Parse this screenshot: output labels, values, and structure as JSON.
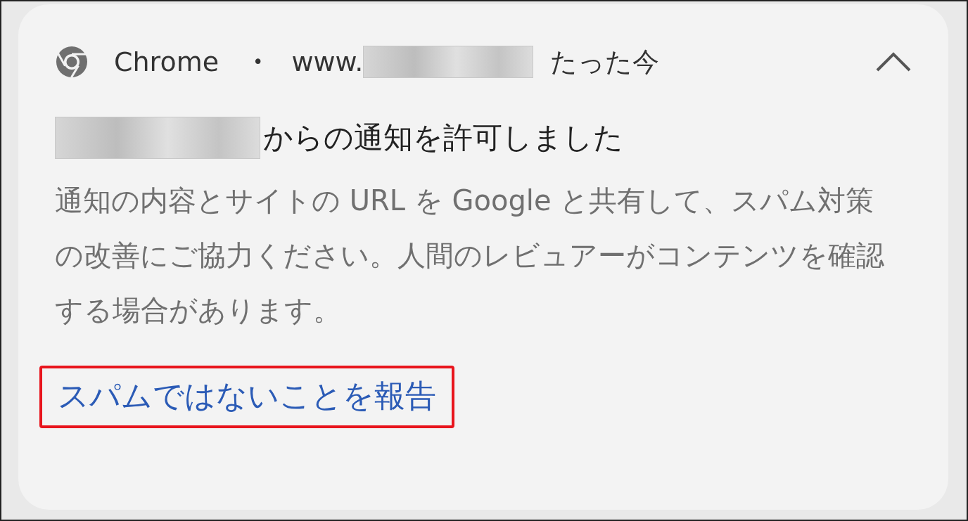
{
  "notification": {
    "app_name": "Chrome",
    "separator": "•",
    "site_prefix": "www.",
    "site_redacted": true,
    "time": "たった今",
    "expanded": true,
    "title_redacted": true,
    "title": "からの通知を許可しました",
    "body": "通知の内容とサイトの URL を Google と共有して、スパム対策の改善にご協力ください。人間のレビュアーがコンテンツを確認する場合があります。",
    "action": {
      "label": "スパムではないことを報告",
      "highlighted": true
    }
  }
}
